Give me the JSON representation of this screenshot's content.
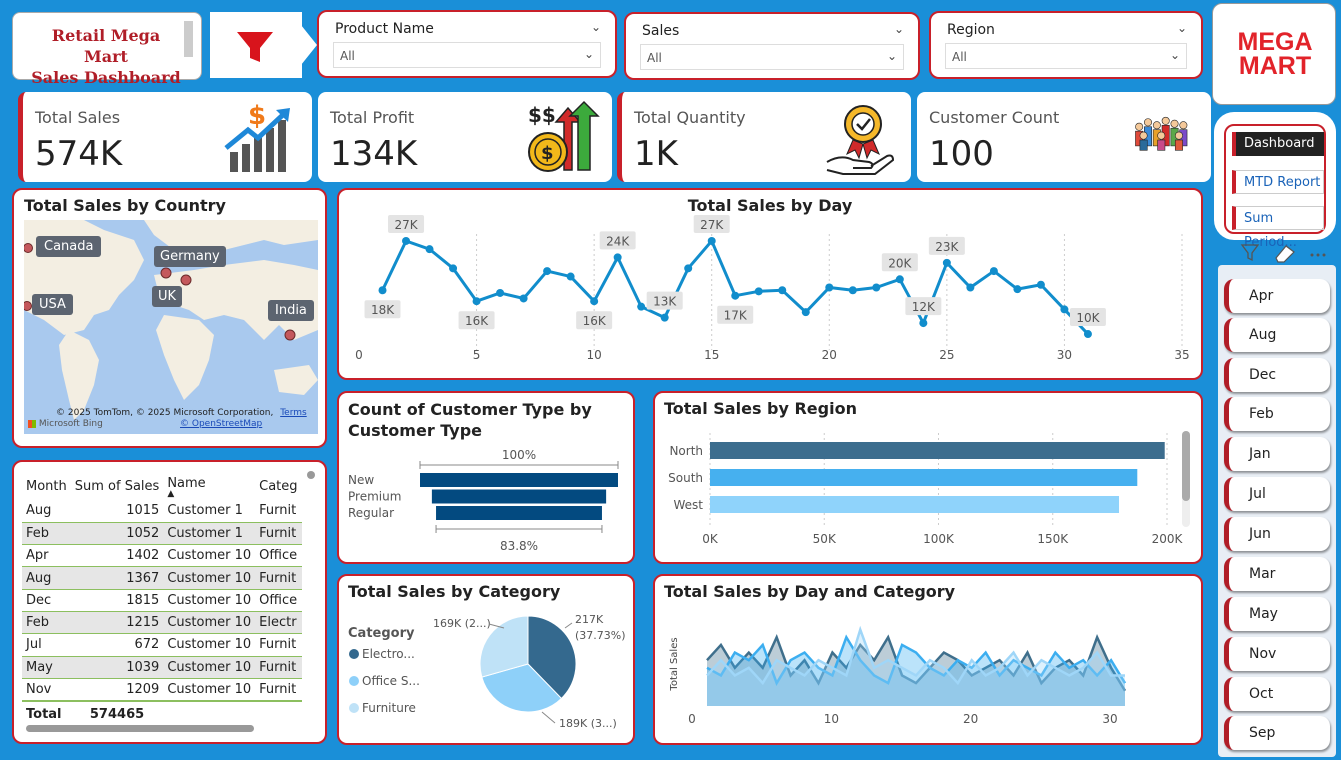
{
  "header": {
    "title": "Retail Mega Mart Sales Dashboard",
    "title_line1": "Retail Mega Mart",
    "title_line2": "Sales Dashboard"
  },
  "slicers": [
    {
      "label": "Product Name",
      "value": "All"
    },
    {
      "label": "Sales",
      "value": "All"
    },
    {
      "label": "Region",
      "value": "All"
    }
  ],
  "logo": {
    "line1": "MEGA",
    "line2": "MART"
  },
  "nav": {
    "dashboard": "Dashboard",
    "mtd": "MTD Report",
    "sum_period": "Sum Period..."
  },
  "months": [
    "Apr",
    "Aug",
    "Dec",
    "Feb",
    "Jan",
    "Jul",
    "Jun",
    "Mar",
    "May",
    "Nov",
    "Oct",
    "Sep"
  ],
  "kpis": [
    {
      "label": "Total Sales",
      "value": "574K",
      "icon": "sales-growth-icon"
    },
    {
      "label": "Total Profit",
      "value": "134K",
      "icon": "profit-coins-icon"
    },
    {
      "label": "Total Quantity",
      "value": "1K",
      "icon": "quality-badge-hand-icon"
    },
    {
      "label": "Customer Count",
      "value": "100",
      "icon": "customer-group-icon"
    }
  ],
  "map": {
    "title": "Total Sales by Country",
    "labels": [
      "Canada",
      "Germany",
      "UK",
      "USA",
      "India"
    ],
    "attribution": "© 2025 TomTom, © 2025 Microsoft Corporation,",
    "terms": "Terms",
    "osm": "© OpenStreetMap",
    "bing": "Microsoft Bing"
  },
  "table": {
    "headers": [
      "Month",
      "Sum of Sales",
      "Name",
      "Categ"
    ],
    "rows": [
      [
        "Aug",
        "1015",
        "Customer 1",
        "Furnit"
      ],
      [
        "Feb",
        "1052",
        "Customer 1",
        "Furnit"
      ],
      [
        "Apr",
        "1402",
        "Customer 10",
        "Office"
      ],
      [
        "Aug",
        "1367",
        "Customer 10",
        "Furnit"
      ],
      [
        "Dec",
        "1815",
        "Customer 10",
        "Office"
      ],
      [
        "Feb",
        "1215",
        "Customer 10",
        "Electr"
      ],
      [
        "Jul",
        "672",
        "Customer 10",
        "Furnit"
      ],
      [
        "May",
        "1039",
        "Customer 10",
        "Furnit"
      ],
      [
        "Nov",
        "1209",
        "Customer 10",
        "Furnit"
      ]
    ],
    "total_label": "Total",
    "total_value": "574465"
  },
  "chart_data": [
    {
      "type": "line",
      "title": "Total Sales by Day",
      "x": [
        1,
        2,
        3,
        4,
        5,
        6,
        7,
        8,
        9,
        10,
        11,
        12,
        13,
        14,
        15,
        16,
        17,
        18,
        19,
        20,
        21,
        22,
        23,
        24,
        25,
        26,
        27,
        28,
        29,
        30,
        31
      ],
      "values": [
        18000,
        27000,
        25500,
        22000,
        16000,
        17500,
        16500,
        21500,
        20500,
        16000,
        24000,
        15000,
        13000,
        22000,
        27000,
        17000,
        17800,
        18000,
        14000,
        18500,
        18000,
        18500,
        20000,
        12000,
        23000,
        18500,
        21500,
        18200,
        19000,
        14500,
        10000
      ],
      "data_labels": {
        "1": "18K",
        "2": "27K",
        "5": "16K",
        "10": "16K",
        "11": "24K",
        "13": "13K",
        "15": "27K",
        "16": "17K",
        "23": "20K",
        "24": "12K",
        "25": "23K",
        "31": "10K"
      },
      "xticks": [
        "0",
        "5",
        "10",
        "15",
        "20",
        "25",
        "30",
        "35"
      ],
      "xlim": [
        0,
        35
      ],
      "color": "#118dcc"
    },
    {
      "type": "bar",
      "title": "Count of Customer Type by Customer Type",
      "title_line1": "Count of Customer Type by",
      "title_line2": "Customer Type",
      "categories": [
        "New",
        "Premium",
        "Regular"
      ],
      "values": [
        100,
        88,
        83.8
      ],
      "top_label": "100%",
      "bottom_label": "83.8%",
      "color": "#034a80"
    },
    {
      "type": "bar",
      "title": "Total Sales by Region",
      "categories": [
        "North",
        "South",
        "West"
      ],
      "values": [
        199000,
        187000,
        179000
      ],
      "colors": [
        "#3c6d8e",
        "#46b0ef",
        "#8fd3fb"
      ],
      "xticks": [
        "0K",
        "50K",
        "100K",
        "150K",
        "200K"
      ],
      "xlim": [
        0,
        200000
      ]
    },
    {
      "type": "pie",
      "title": "Total Sales by Category",
      "legend_title": "Category",
      "legend": [
        "Electro...",
        "Office S...",
        "Furniture"
      ],
      "values": [
        217000,
        189000,
        169000
      ],
      "slice_labels": [
        "217K (37.73%)",
        "189K (3...)",
        "169K (2...)"
      ],
      "colors": [
        "#34698e",
        "#8ed0f9",
        "#bfe2f7"
      ]
    },
    {
      "type": "area",
      "title": "Total Sales by Day and Category",
      "ylabel": "Total Sales",
      "xticks": [
        "0",
        "10",
        "20",
        "30"
      ],
      "xlim": [
        0,
        31
      ],
      "series": [
        {
          "values": [
            6,
            8,
            5,
            7,
            5,
            9,
            4,
            6,
            3,
            7,
            5,
            8,
            6,
            9,
            4,
            3,
            5,
            7,
            6,
            4,
            5,
            6,
            4,
            7,
            3,
            5,
            6,
            4,
            9,
            5,
            2
          ],
          "color": "#3f6f8c"
        },
        {
          "values": [
            5,
            4,
            7,
            6,
            8,
            3,
            6,
            7,
            5,
            4,
            9,
            6,
            4,
            3,
            8,
            7,
            5,
            4,
            6,
            5,
            7,
            4,
            6,
            5,
            4,
            7,
            5,
            6,
            4,
            6,
            3
          ],
          "color": "#3caef0"
        },
        {
          "values": [
            4,
            6,
            4,
            5,
            3,
            6,
            5,
            4,
            6,
            5,
            4,
            10,
            5,
            6,
            5,
            4,
            6,
            5,
            3,
            6,
            4,
            5,
            7,
            4,
            6,
            5,
            4,
            5,
            7,
            4,
            4
          ],
          "color": "#9fd6f8"
        }
      ]
    }
  ]
}
